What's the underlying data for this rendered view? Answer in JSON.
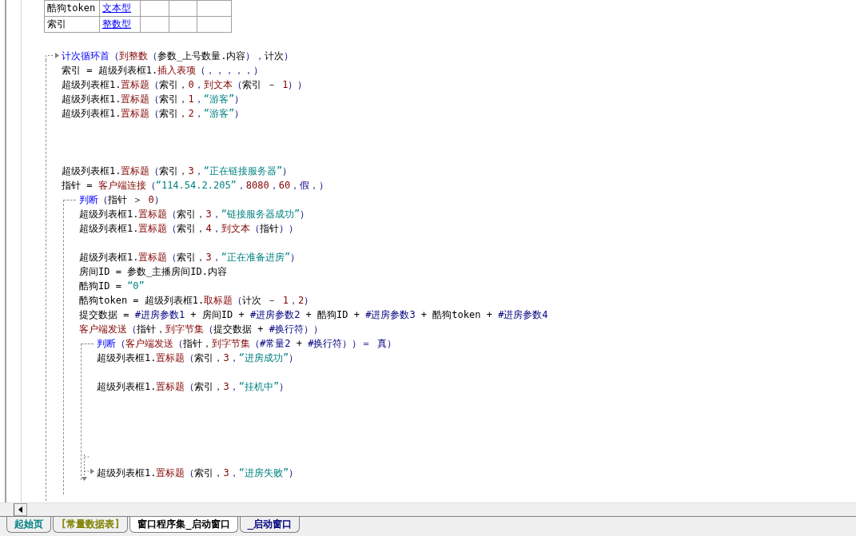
{
  "var_table": {
    "rows": [
      {
        "name": "酷狗token",
        "type": "文本型"
      },
      {
        "name": "索引",
        "type": "整数型"
      }
    ]
  },
  "code": [
    {
      "kind": "loop",
      "head": [
        {
          "kind": "flow",
          "text": "计次循环首"
        },
        {
          "kind": "punct",
          "text": "（"
        },
        {
          "kind": "func",
          "text": "到整数"
        },
        {
          "kind": "punct",
          "text": "（"
        },
        {
          "kind": "text",
          "text": "参数_上号数量.内容"
        },
        {
          "kind": "punct",
          "text": "），"
        },
        {
          "kind": "text",
          "text": "计次"
        },
        {
          "kind": "punct",
          "text": "）"
        }
      ],
      "children": [
        {
          "kind": "line",
          "segments": [
            {
              "kind": "text",
              "text": "索引 = 超级列表框1."
            },
            {
              "kind": "func",
              "text": "插入表项"
            },
            {
              "kind": "punct",
              "text": "（，，，，，）"
            }
          ]
        },
        {
          "kind": "line",
          "segments": [
            {
              "kind": "text",
              "text": "超级列表框1."
            },
            {
              "kind": "func",
              "text": "置标题"
            },
            {
              "kind": "punct",
              "text": "（"
            },
            {
              "kind": "text",
              "text": "索引，"
            },
            {
              "kind": "num",
              "text": "0"
            },
            {
              "kind": "punct",
              "text": "，"
            },
            {
              "kind": "func",
              "text": "到文本"
            },
            {
              "kind": "punct",
              "text": "（"
            },
            {
              "kind": "text",
              "text": "索引 － "
            },
            {
              "kind": "num",
              "text": "1"
            },
            {
              "kind": "punct",
              "text": "））"
            }
          ]
        },
        {
          "kind": "line",
          "segments": [
            {
              "kind": "text",
              "text": "超级列表框1."
            },
            {
              "kind": "func",
              "text": "置标题"
            },
            {
              "kind": "punct",
              "text": "（"
            },
            {
              "kind": "text",
              "text": "索引，"
            },
            {
              "kind": "num",
              "text": "1"
            },
            {
              "kind": "punct",
              "text": "，"
            },
            {
              "kind": "str",
              "text": "“游客”"
            },
            {
              "kind": "punct",
              "text": "）"
            }
          ]
        },
        {
          "kind": "line",
          "segments": [
            {
              "kind": "text",
              "text": "超级列表框1."
            },
            {
              "kind": "func",
              "text": "置标题"
            },
            {
              "kind": "punct",
              "text": "（"
            },
            {
              "kind": "text",
              "text": "索引，"
            },
            {
              "kind": "num",
              "text": "2"
            },
            {
              "kind": "punct",
              "text": "，"
            },
            {
              "kind": "str",
              "text": "“游客”"
            },
            {
              "kind": "punct",
              "text": "）"
            }
          ]
        },
        {
          "kind": "blank"
        },
        {
          "kind": "blank"
        },
        {
          "kind": "blank"
        },
        {
          "kind": "line",
          "segments": [
            {
              "kind": "text",
              "text": "超级列表框1."
            },
            {
              "kind": "func",
              "text": "置标题"
            },
            {
              "kind": "punct",
              "text": "（"
            },
            {
              "kind": "text",
              "text": "索引，"
            },
            {
              "kind": "num",
              "text": "3"
            },
            {
              "kind": "punct",
              "text": "，"
            },
            {
              "kind": "str",
              "text": "“正在链接服务器”"
            },
            {
              "kind": "punct",
              "text": "）"
            }
          ]
        },
        {
          "kind": "line",
          "segments": [
            {
              "kind": "text",
              "text": "指针 = "
            },
            {
              "kind": "func",
              "text": "客户端连接"
            },
            {
              "kind": "punct",
              "text": "（"
            },
            {
              "kind": "str",
              "text": "“114.54.2.205”"
            },
            {
              "kind": "punct",
              "text": "，"
            },
            {
              "kind": "num",
              "text": "8080"
            },
            {
              "kind": "punct",
              "text": "，"
            },
            {
              "kind": "num",
              "text": "60"
            },
            {
              "kind": "punct",
              "text": "，假，）"
            }
          ]
        },
        {
          "kind": "if",
          "head": [
            {
              "kind": "flow",
              "text": "判断"
            },
            {
              "kind": "punct",
              "text": "（"
            },
            {
              "kind": "text",
              "text": "指针 ＞ "
            },
            {
              "kind": "num",
              "text": "0"
            },
            {
              "kind": "punct",
              "text": "）"
            }
          ],
          "children": [
            {
              "kind": "line",
              "segments": [
                {
                  "kind": "text",
                  "text": "超级列表框1."
                },
                {
                  "kind": "func",
                  "text": "置标题"
                },
                {
                  "kind": "punct",
                  "text": "（"
                },
                {
                  "kind": "text",
                  "text": "索引，"
                },
                {
                  "kind": "num",
                  "text": "3"
                },
                {
                  "kind": "punct",
                  "text": "，"
                },
                {
                  "kind": "str",
                  "text": "“链接服务器成功”"
                },
                {
                  "kind": "punct",
                  "text": "）"
                }
              ]
            },
            {
              "kind": "line",
              "segments": [
                {
                  "kind": "text",
                  "text": "超级列表框1."
                },
                {
                  "kind": "func",
                  "text": "置标题"
                },
                {
                  "kind": "punct",
                  "text": "（"
                },
                {
                  "kind": "text",
                  "text": "索引，"
                },
                {
                  "kind": "num",
                  "text": "4"
                },
                {
                  "kind": "punct",
                  "text": "，"
                },
                {
                  "kind": "func",
                  "text": "到文本"
                },
                {
                  "kind": "punct",
                  "text": "（"
                },
                {
                  "kind": "text",
                  "text": "指针"
                },
                {
                  "kind": "punct",
                  "text": "））"
                }
              ]
            },
            {
              "kind": "blank"
            },
            {
              "kind": "line",
              "segments": [
                {
                  "kind": "text",
                  "text": "超级列表框1."
                },
                {
                  "kind": "func",
                  "text": "置标题"
                },
                {
                  "kind": "punct",
                  "text": "（"
                },
                {
                  "kind": "text",
                  "text": "索引，"
                },
                {
                  "kind": "num",
                  "text": "3"
                },
                {
                  "kind": "punct",
                  "text": "，"
                },
                {
                  "kind": "str",
                  "text": "“正在准备进房”"
                },
                {
                  "kind": "punct",
                  "text": "）"
                }
              ]
            },
            {
              "kind": "line",
              "segments": [
                {
                  "kind": "text",
                  "text": "房间ID = 参数_主播房间ID.内容"
                }
              ]
            },
            {
              "kind": "line",
              "segments": [
                {
                  "kind": "text",
                  "text": "酷狗ID = "
                },
                {
                  "kind": "str",
                  "text": "“0”"
                }
              ]
            },
            {
              "kind": "line",
              "segments": [
                {
                  "kind": "text",
                  "text": "酷狗token = 超级列表框1."
                },
                {
                  "kind": "func",
                  "text": "取标题"
                },
                {
                  "kind": "punct",
                  "text": "（"
                },
                {
                  "kind": "text",
                  "text": "计次 － "
                },
                {
                  "kind": "num",
                  "text": "1"
                },
                {
                  "kind": "punct",
                  "text": "，"
                },
                {
                  "kind": "num",
                  "text": "2"
                },
                {
                  "kind": "punct",
                  "text": "）"
                }
              ]
            },
            {
              "kind": "line",
              "segments": [
                {
                  "kind": "text",
                  "text": "提交数据 = "
                },
                {
                  "kind": "const",
                  "text": "#进房参数1"
                },
                {
                  "kind": "text",
                  "text": " + 房间ID + "
                },
                {
                  "kind": "const",
                  "text": "#进房参数2"
                },
                {
                  "kind": "text",
                  "text": " + 酷狗ID + "
                },
                {
                  "kind": "const",
                  "text": "#进房参数3"
                },
                {
                  "kind": "text",
                  "text": " + 酷狗token + "
                },
                {
                  "kind": "const",
                  "text": "#进房参数4"
                }
              ]
            },
            {
              "kind": "line",
              "segments": [
                {
                  "kind": "func",
                  "text": "客户端发送"
                },
                {
                  "kind": "punct",
                  "text": "（"
                },
                {
                  "kind": "text",
                  "text": "指针，"
                },
                {
                  "kind": "func",
                  "text": "到字节集"
                },
                {
                  "kind": "punct",
                  "text": "（"
                },
                {
                  "kind": "text",
                  "text": "提交数据 + "
                },
                {
                  "kind": "const",
                  "text": "#换行符"
                },
                {
                  "kind": "punct",
                  "text": "））"
                }
              ]
            },
            {
              "kind": "if",
              "head": [
                {
                  "kind": "flow",
                  "text": "判断"
                },
                {
                  "kind": "punct",
                  "text": "（"
                },
                {
                  "kind": "func",
                  "text": "客户端发送"
                },
                {
                  "kind": "punct",
                  "text": "（"
                },
                {
                  "kind": "text",
                  "text": "指针，"
                },
                {
                  "kind": "func",
                  "text": "到字节集"
                },
                {
                  "kind": "punct",
                  "text": "（"
                },
                {
                  "kind": "const",
                  "text": "#常量2"
                },
                {
                  "kind": "text",
                  "text": " + "
                },
                {
                  "kind": "const",
                  "text": "#换行符"
                },
                {
                  "kind": "punct",
                  "text": "））＝ 真）"
                }
              ],
              "children": [
                {
                  "kind": "line",
                  "segments": [
                    {
                      "kind": "text",
                      "text": "超级列表框1."
                    },
                    {
                      "kind": "func",
                      "text": "置标题"
                    },
                    {
                      "kind": "punct",
                      "text": "（"
                    },
                    {
                      "kind": "text",
                      "text": "索引，"
                    },
                    {
                      "kind": "num",
                      "text": "3"
                    },
                    {
                      "kind": "punct",
                      "text": "，"
                    },
                    {
                      "kind": "str",
                      "text": "“进房成功”"
                    },
                    {
                      "kind": "punct",
                      "text": "）"
                    }
                  ]
                },
                {
                  "kind": "blank"
                },
                {
                  "kind": "line",
                  "segments": [
                    {
                      "kind": "text",
                      "text": "超级列表框1."
                    },
                    {
                      "kind": "func",
                      "text": "置标题"
                    },
                    {
                      "kind": "punct",
                      "text": "（"
                    },
                    {
                      "kind": "text",
                      "text": "索引，"
                    },
                    {
                      "kind": "num",
                      "text": "3"
                    },
                    {
                      "kind": "punct",
                      "text": "，"
                    },
                    {
                      "kind": "str",
                      "text": "“挂机中”"
                    },
                    {
                      "kind": "punct",
                      "text": "）"
                    }
                  ]
                },
                {
                  "kind": "blank"
                },
                {
                  "kind": "blank"
                },
                {
                  "kind": "blank"
                },
                {
                  "kind": "blank"
                },
                {
                  "kind": "blank"
                }
              ],
              "else": [
                {
                  "kind": "line",
                  "segments": [
                    {
                      "kind": "text",
                      "text": "超级列表框1."
                    },
                    {
                      "kind": "func",
                      "text": "置标题"
                    },
                    {
                      "kind": "punct",
                      "text": "（"
                    },
                    {
                      "kind": "text",
                      "text": "索引，"
                    },
                    {
                      "kind": "num",
                      "text": "3"
                    },
                    {
                      "kind": "punct",
                      "text": "，"
                    },
                    {
                      "kind": "str",
                      "text": "“进房失败”"
                    },
                    {
                      "kind": "punct",
                      "text": "）"
                    }
                  ]
                }
              ]
            },
            {
              "kind": "blank"
            }
          ]
        },
        {
          "kind": "blank"
        }
      ]
    }
  ],
  "tabs": [
    {
      "label": "起始页",
      "selected": false,
      "color": "#008080"
    },
    {
      "label": "[常量数据表]",
      "selected": false,
      "color": "#808000"
    },
    {
      "label": "窗口程序集_启动窗口",
      "selected": true,
      "color": "#000000"
    },
    {
      "label": "_启动窗口",
      "selected": false,
      "color": "#000080"
    }
  ]
}
